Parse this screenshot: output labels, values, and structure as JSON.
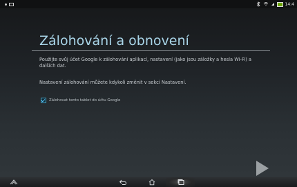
{
  "status_bar": {
    "time": "14:4",
    "battery_color": "#6aa400"
  },
  "setup": {
    "title": "Zálohování a obnovení",
    "paragraph1": "Použijte svůj účet Google k zálohování aplikací, nastavení (jako jsou záložky a hesla Wi-Fi) a dalších dat.",
    "paragraph2": "Nastavení zálohování můžete kdykoli změnit v sekci Nastavení.",
    "checkbox_label": "Zálohovat tento tablet do účtu Google",
    "checkbox_checked": true,
    "accent_color": "#a9d5e8"
  },
  "nav": {
    "icons": [
      "asus-icon",
      "back-icon",
      "home-icon",
      "recent-apps-icon"
    ]
  }
}
